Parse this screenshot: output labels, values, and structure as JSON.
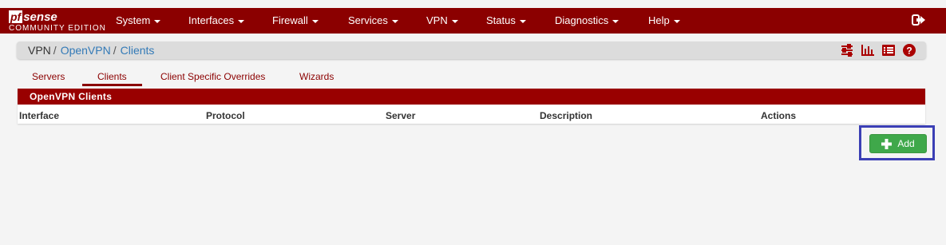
{
  "brand": {
    "logo_pf": "pf",
    "logo_sense": "sense",
    "edition": "COMMUNITY EDITION"
  },
  "nav": {
    "items": [
      {
        "label": "System"
      },
      {
        "label": "Interfaces"
      },
      {
        "label": "Firewall"
      },
      {
        "label": "Services"
      },
      {
        "label": "VPN"
      },
      {
        "label": "Status"
      },
      {
        "label": "Diagnostics"
      },
      {
        "label": "Help"
      }
    ]
  },
  "breadcrumb": {
    "vpn": "VPN",
    "openvpn": "OpenVPN",
    "clients": "Clients",
    "separator": "/"
  },
  "tabs": [
    {
      "label": "Servers"
    },
    {
      "label": "Clients"
    },
    {
      "label": "Client Specific Overrides"
    },
    {
      "label": "Wizards"
    }
  ],
  "panel": {
    "heading": "OpenVPN Clients",
    "columns": [
      "Interface",
      "Protocol",
      "Server",
      "Description",
      "Actions"
    ]
  },
  "actions": {
    "add_label": "Add"
  },
  "colors": {
    "brand": "#8b0000",
    "panel_heading": "#990000",
    "link": "#337ab7",
    "add_button": "#3fa84a",
    "highlight": "#3b3fb5"
  },
  "icons": {
    "logout": "sign-out-icon",
    "settings": "sliders-icon",
    "chart": "bar-chart-icon",
    "logs": "list-icon",
    "help": "question-circle-icon",
    "add": "plus-icon"
  }
}
